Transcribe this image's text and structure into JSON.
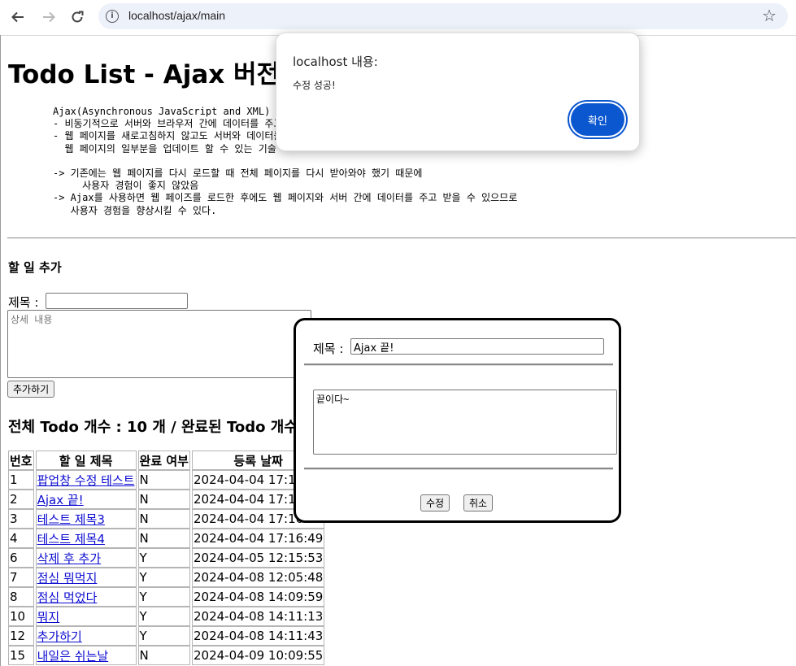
{
  "browser": {
    "url": "localhost/ajax/main"
  },
  "page": {
    "title": "Todo List - Ajax 버전",
    "description": "Ajax(Asynchronous JavaScript and XML)\n- 비동기적으로 서버와 브라우저 간에 데이터를 주고 받는 기술\n- 웹 페이지를 새로고침하지 않고도 서버와 데이터를 주고받아\n  웹 페이지의 일부분을 업데이트 할 수 있는 기술\n\n-> 기존에는 웹 페이지를 다시 로드할 때 전체 페이지를 다시 받아와야 했기 때문에\n     사용자 경험이 좋지 않았음\n-> Ajax를 사용하면 웹 페이즈를 로드한 후에도 웹 페이지와 서버 간에 데이터를 주고 받을 수 있으므로\n   사용자 경험을 향상시킬 수 있다.",
    "add_heading": "할 일 추가",
    "title_label": "제목 :",
    "title_value": "",
    "detail_placeholder": "상세 내용",
    "add_button": "추가하기",
    "summary": "전체 Todo 개수 : 10 개 / 완료된 Todo 개수"
  },
  "table": {
    "headers": [
      "번호",
      "할 일 제목",
      "완료 여부",
      "등록 날짜"
    ],
    "rows": [
      {
        "no": "1",
        "title": "팝업창 수정 테스트",
        "done": "N",
        "date": "2024-04-04 17:16:20"
      },
      {
        "no": "2",
        "title": "Ajax 끝!",
        "done": "N",
        "date": "2024-04-04 17:16:30"
      },
      {
        "no": "3",
        "title": "테스트 제목3",
        "done": "N",
        "date": "2024-04-04 17:16:40"
      },
      {
        "no": "4",
        "title": "테스트 제목4",
        "done": "N",
        "date": "2024-04-04 17:16:49"
      },
      {
        "no": "6",
        "title": "삭제 후 추가",
        "done": "Y",
        "date": "2024-04-05 12:15:53"
      },
      {
        "no": "7",
        "title": "점심 뭐먹지",
        "done": "Y",
        "date": "2024-04-08 12:05:48"
      },
      {
        "no": "8",
        "title": "점심 먹었다",
        "done": "Y",
        "date": "2024-04-08 14:09:59"
      },
      {
        "no": "10",
        "title": "뭐지",
        "done": "Y",
        "date": "2024-04-08 14:11:13"
      },
      {
        "no": "12",
        "title": "추가하기",
        "done": "Y",
        "date": "2024-04-08 14:11:43"
      },
      {
        "no": "15",
        "title": "내일은 쉬는날",
        "done": "N",
        "date": "2024-04-09 10:09:55"
      }
    ]
  },
  "modal": {
    "title_label": "제목 :",
    "title_value": "Ajax 끝!",
    "content_value": "끝이다~",
    "save_button": "수정",
    "cancel_button": "취소"
  },
  "alert": {
    "title": "localhost 내용:",
    "message": "수정 성공!",
    "ok_button": "확인"
  },
  "colors": {
    "accent": "#0b57d0",
    "link": "#0b0bd0"
  },
  "icons": [
    "back-icon",
    "forward-icon",
    "reload-icon",
    "info-icon",
    "star-icon"
  ]
}
